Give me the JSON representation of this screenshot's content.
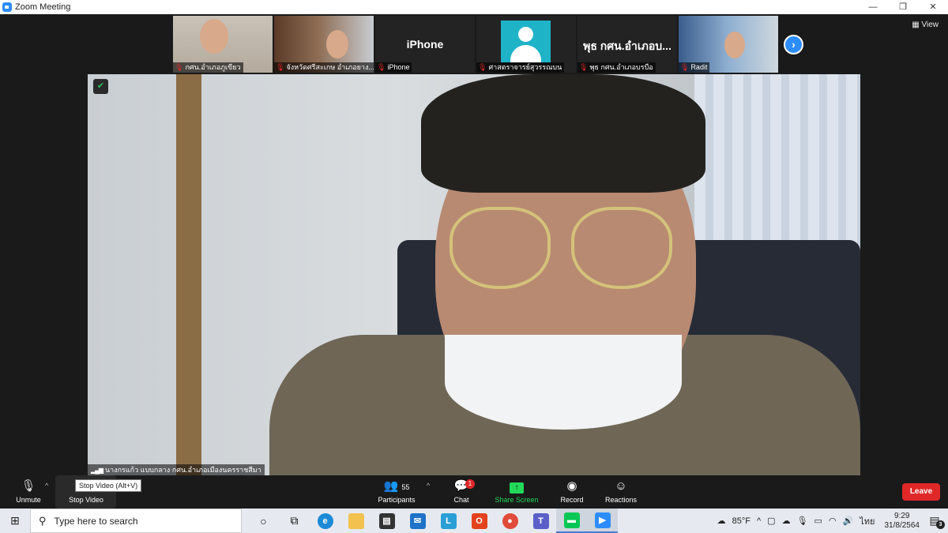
{
  "window": {
    "title": "Zoom Meeting",
    "controls": [
      "—",
      "❐",
      "✕"
    ]
  },
  "gallery": {
    "tiles": [
      {
        "name": "กศน.อำเภอภูเขียว"
      },
      {
        "name": "จังหวัดศรีสะเกษ อำเภอยาง..."
      },
      {
        "name": "iPhone",
        "big_name": "iPhone"
      },
      {
        "name": "ศาสตราจารย์สุวรรณบน"
      },
      {
        "name": "พุธ กศน.อำเภอบรบือ",
        "big_name": "พุธ กศน.อำเภอบ..."
      },
      {
        "name": "Radit"
      }
    ],
    "view_label": "View"
  },
  "active_speaker": {
    "name": "นางกรแก้ว แบบกลาง กศน.อำเภอเมืองนครราชสีมา"
  },
  "toolbar": {
    "unmute": "Unmute",
    "stop_video": "Stop Video",
    "stop_video_tooltip": "Stop Video (Alt+V)",
    "participants": "Participants",
    "participants_count": "55",
    "chat": "Chat",
    "chat_badge": "1",
    "share_screen": "Share Screen",
    "record": "Record",
    "reactions": "Reactions",
    "leave": "Leave"
  },
  "taskbar": {
    "search_placeholder": "Type here to search",
    "weather": "85°F",
    "language": "ไทย",
    "time": "9:29",
    "date": "31/8/2564",
    "notification_count": "3"
  },
  "colors": {
    "zoom_blue": "#2d8cff",
    "leave_red": "#e02828",
    "share_green": "#23d959"
  }
}
